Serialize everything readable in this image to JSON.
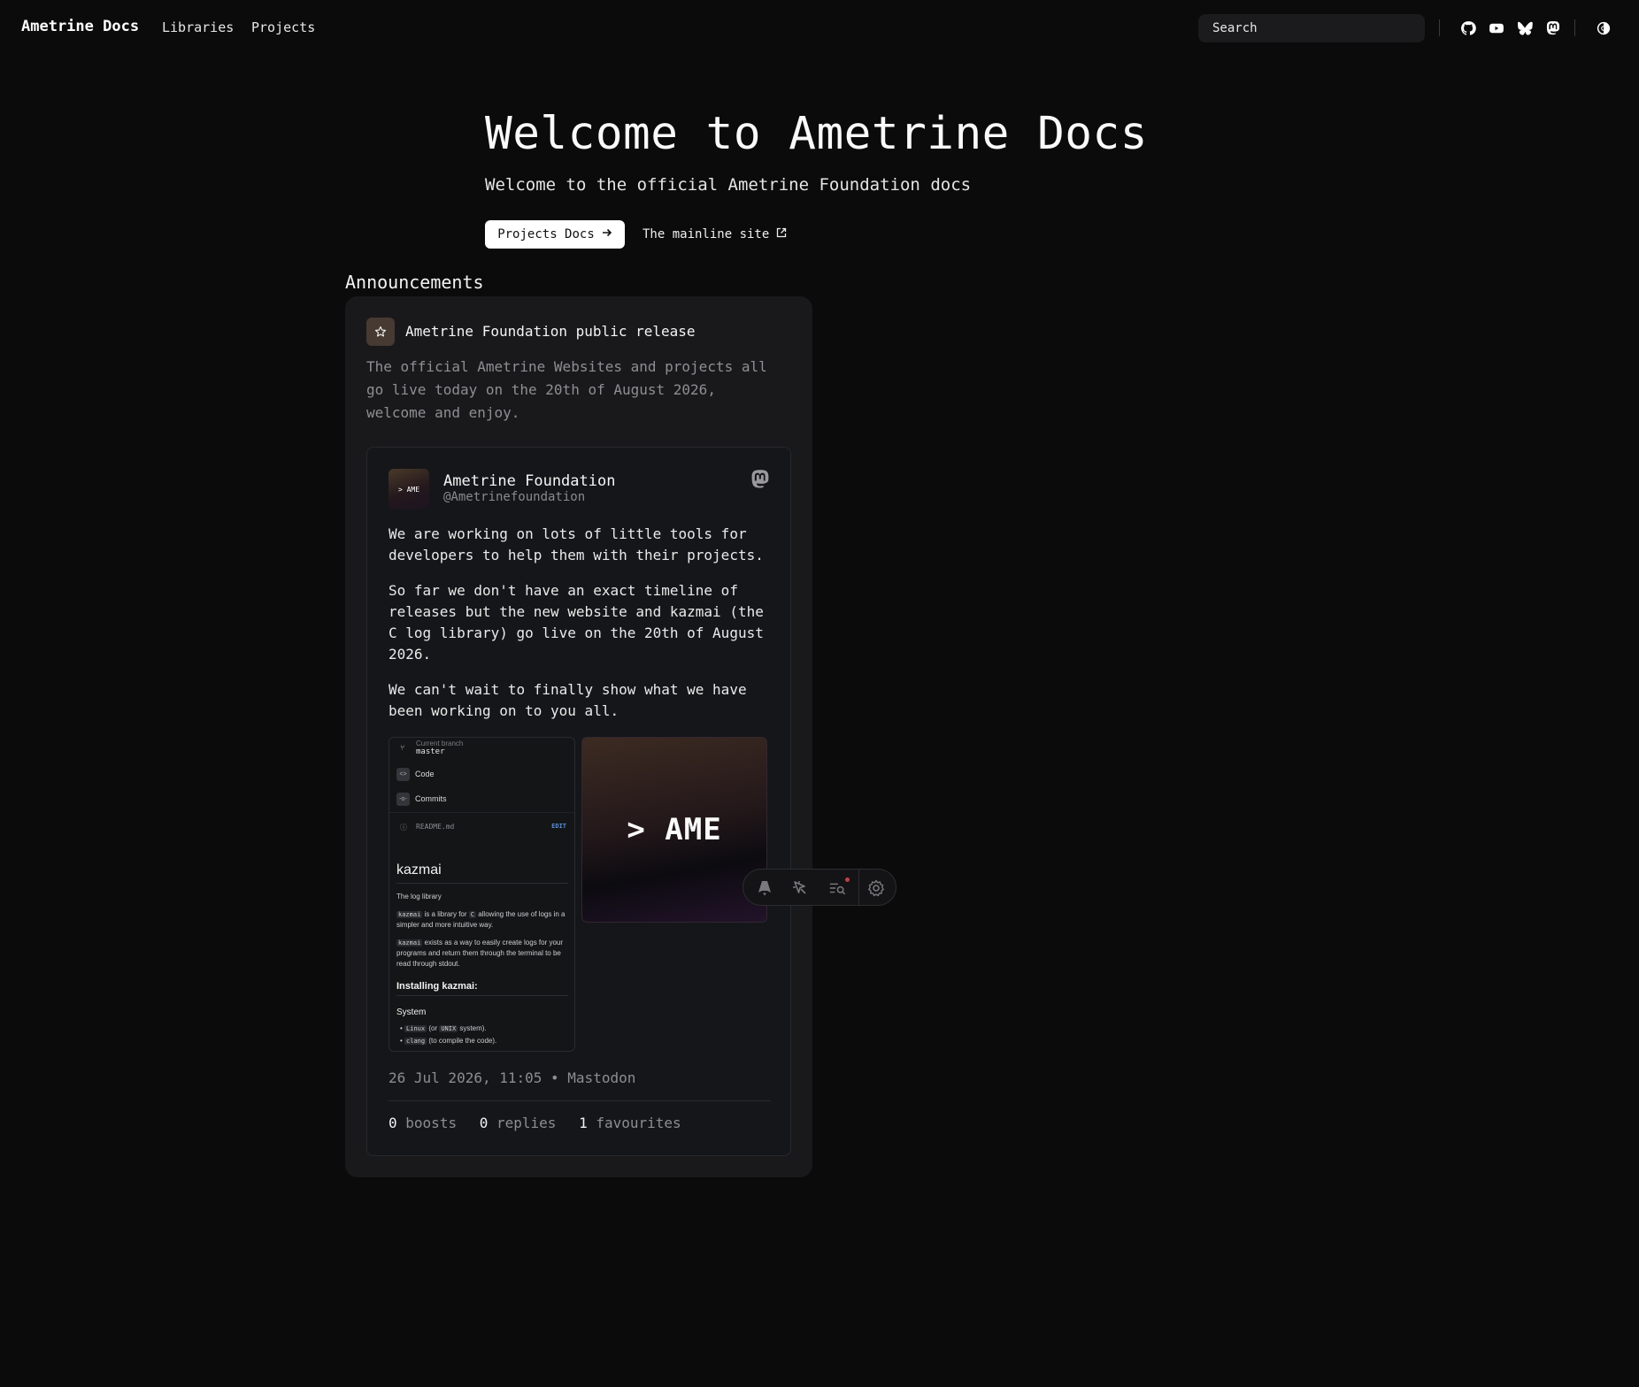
{
  "nav": {
    "brand": "Ametrine Docs",
    "links": [
      "Libraries",
      "Projects"
    ],
    "search_label": "Search",
    "icons": [
      "github-icon",
      "youtube-icon",
      "bluesky-icon",
      "mastodon-icon",
      "theme-toggle-icon"
    ]
  },
  "hero": {
    "title": "Welcome to Ametrine Docs",
    "subtitle": "Welcome to the official Ametrine Foundation docs",
    "primary_button": "Projects Docs",
    "secondary_button": "The mainline site"
  },
  "announcements": {
    "heading": "Announcements",
    "item": {
      "title": "Ametrine Foundation public release",
      "body": "The official Ametrine Websites and projects all go live today on the 20th of August 2026, welcome and enjoy."
    }
  },
  "post": {
    "avatar_text": "> AME",
    "name": "Ametrine Foundation",
    "handle": "@Ametrinefoundation",
    "paragraphs": [
      "We are working on lots of little tools for developers to help them with their projects.",
      "So far we don't have an exact timeline of releases but the new website and kazmai (the C log library) go live on the 20th of August 2026.",
      "We can't wait to finally show what we have been working on to you all."
    ],
    "media1": {
      "branch_label": "Current branch",
      "branch": "master",
      "code": "Code",
      "commits": "Commits",
      "readme": "README.md",
      "edit": "EDIT",
      "heading": "kazmai",
      "tagline": "The log library",
      "p1_code": "kazmai",
      "p1_a": " is a library for ",
      "p1_lang": "C",
      "p1_b": " allowing the use of logs in a simpler and more intuitive way.",
      "p2_code": "kazmai",
      "p2_b": " exists as a way to easily create logs for your programs and return them through the terminal to be read through stdout.",
      "install_heading": "Installing kazmai:",
      "system_heading": "System",
      "li1_code": "Linux",
      "li1_a": " (or ",
      "li1_code2": "UNIX",
      "li1_b": " system).",
      "li2_code": "clang",
      "li2_b": " (to compile the code)."
    },
    "media2_label": "> AME",
    "meta": "26 Jul 2026, 11:05 • Mastodon",
    "stats": {
      "boosts_count": "0",
      "boosts_label": "boosts",
      "replies_count": "0",
      "replies_label": "replies",
      "favourites_count": "1",
      "favourites_label": "favourites"
    }
  },
  "toolbar": {
    "icons": [
      "astro-icon",
      "inspect-cursor-icon",
      "audit-icon",
      "settings-gear-icon"
    ]
  },
  "colors": {
    "background": "#0b0b0c",
    "card": "#19191b",
    "post": "#151619",
    "muted_text": "#8f8f93"
  }
}
